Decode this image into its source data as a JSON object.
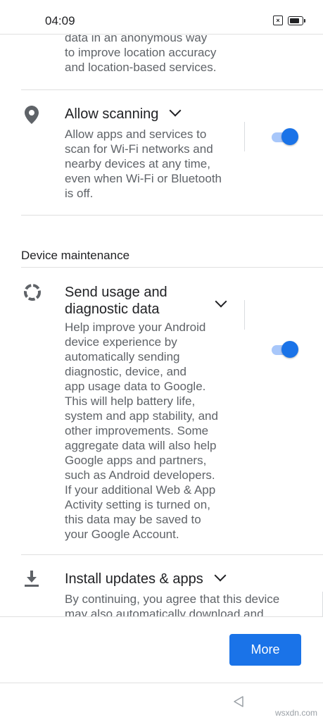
{
  "status_bar": {
    "time": "04:09"
  },
  "location_section": {
    "trailing_text": "data in an anonymous way\nto improve location accuracy\nand location-based services."
  },
  "scanning": {
    "title": "Allow scanning",
    "description": "Allow apps and services to\nscan for Wi-Fi networks and\nnearby devices at any time,\neven when Wi-Fi or Bluetooth\nis off.",
    "toggle_on": true
  },
  "device_maintenance": {
    "header": "Device maintenance",
    "usage": {
      "title": "Send usage and\ndiagnostic data",
      "description": "Help improve your Android\ndevice experience by\nautomatically sending\ndiagnostic, device, and\napp usage data to Google.\nThis will help battery life,\nsystem and app stability, and\nother improvements. Some\naggregate data will also help\nGoogle apps and partners,\nsuch as Android developers.\nIf your additional Web & App\nActivity setting is turned on,\nthis data may be saved to\nyour Google Account.",
      "toggle_on": true
    },
    "updates": {
      "title": "Install updates & apps",
      "description": "By continuing, you agree that this device\nmay also automatically download and"
    }
  },
  "footer": {
    "more_label": "More"
  },
  "watermark": "wsxdn.com",
  "colors": {
    "accent": "#1a73e8",
    "track": "#a8c7fa",
    "text": "#202124",
    "secondary": "#5f6368"
  }
}
